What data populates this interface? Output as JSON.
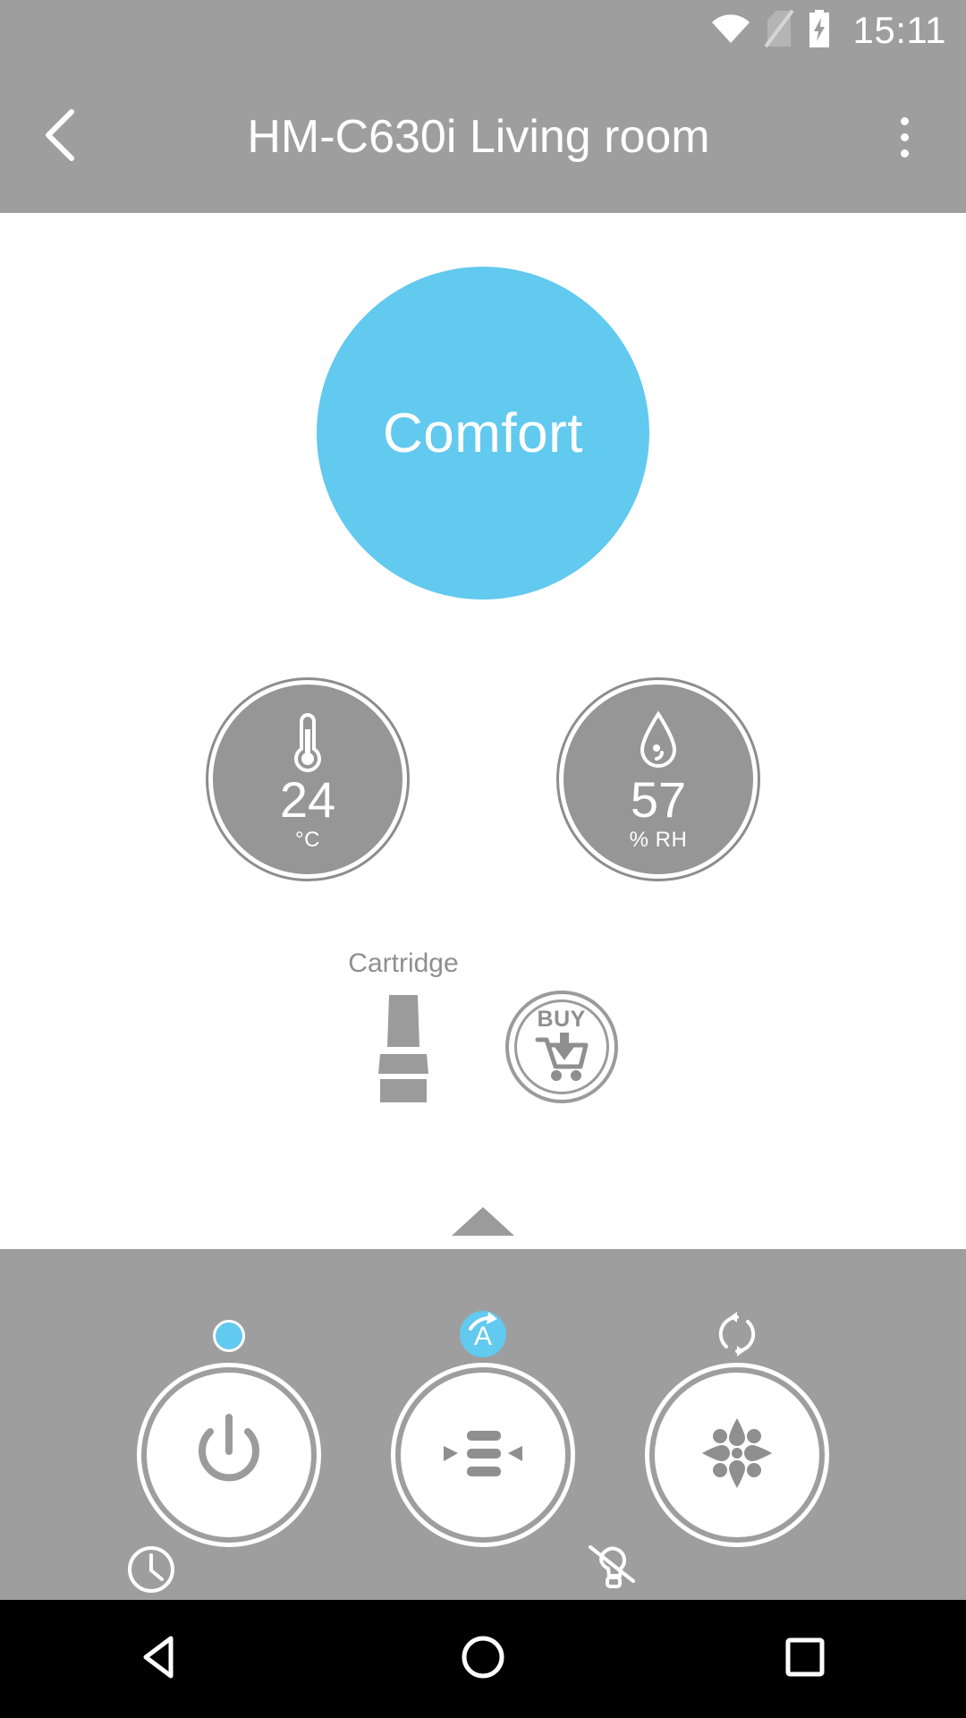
{
  "status_bar": {
    "clock": "15:11",
    "icons": [
      "wifi-icon",
      "sim-card-off-icon",
      "battery-charging-icon"
    ]
  },
  "app_bar": {
    "back_icon": "chevron-left-icon",
    "title": "HM-C630i Living room",
    "overflow_icon": "more-vertical-icon"
  },
  "mode": {
    "label": "Comfort",
    "color": "#62c9ef"
  },
  "sensors": [
    {
      "name": "temperature",
      "icon": "thermometer-icon",
      "value": "24",
      "unit": "°C"
    },
    {
      "name": "humidity",
      "icon": "water-drop-icon",
      "value": "57",
      "unit": "% RH"
    }
  ],
  "cartridge": {
    "label": "Cartridge",
    "icon": "cartridge-icon",
    "buy_label": "BUY",
    "buy_icon": "shopping-cart-download-icon"
  },
  "expander": {
    "icon": "chevron-up-icon"
  },
  "controls": [
    {
      "name": "power",
      "icon": "power-icon",
      "indicator": "led-dot",
      "indicator_color": "#62c9ef",
      "badge": "timer-clock-icon"
    },
    {
      "name": "fan-speed",
      "icon": "fan-speed-levels-icon",
      "indicator": "auto-mode-icon",
      "indicator_color": "#62c9ef",
      "badge": "light-off-icon"
    },
    {
      "name": "humidify",
      "icon": "humidify-flower-icon",
      "indicator": "cycle-rotate-icon",
      "indicator_color": "#ffffff",
      "badge": null
    }
  ],
  "nav_bar": {
    "back": "triangle-back-icon",
    "home": "circle-home-icon",
    "recents": "square-recents-icon"
  },
  "colors": {
    "accent": "#62c9ef",
    "chrome": "#9e9e9e",
    "dial": "#969696",
    "muted_text": "#8f8f8f"
  }
}
